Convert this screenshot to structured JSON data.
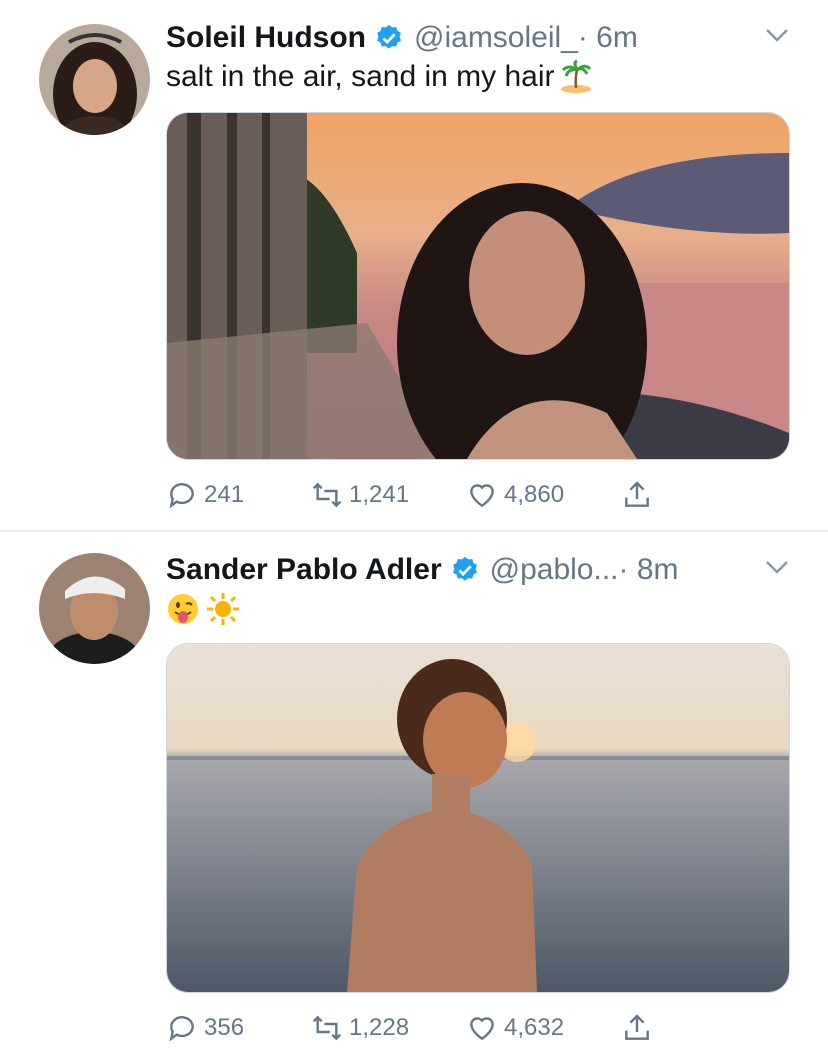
{
  "tweets": [
    {
      "name": "Soleil Hudson",
      "handle": "@iamsoleil_",
      "time": "· 6m",
      "text": "salt in the air, sand in my hair",
      "emoji": "palm-island-emoji",
      "replies": "241",
      "retweets": "1,241",
      "likes": "4,860"
    },
    {
      "name": "Sander Pablo Adler",
      "handle": "@pablo...",
      "time": " · 8m",
      "text": "",
      "emoji": "tongue-face-emoji sun-emoji",
      "replies": "356",
      "retweets": "1,228",
      "likes": "4,632"
    }
  ],
  "colors": {
    "verified": "#1da1f2",
    "secondary": "#657786",
    "divider": "#e6ecf0"
  }
}
